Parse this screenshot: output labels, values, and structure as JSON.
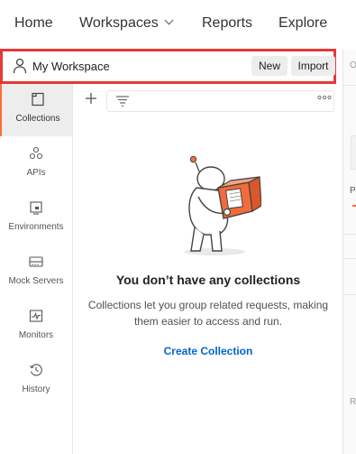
{
  "nav": {
    "items": [
      {
        "label": "Home"
      },
      {
        "label": "Workspaces"
      },
      {
        "label": "Reports"
      },
      {
        "label": "Explore"
      }
    ]
  },
  "workspace": {
    "title": "My Workspace",
    "new_label": "New",
    "import_label": "Import"
  },
  "sidebar": {
    "items": [
      {
        "label": "Collections",
        "icon": "collections-icon",
        "active": true
      },
      {
        "label": "APIs",
        "icon": "apis-icon"
      },
      {
        "label": "Environments",
        "icon": "environments-icon"
      },
      {
        "label": "Mock Servers",
        "icon": "mock-servers-icon"
      },
      {
        "label": "Monitors",
        "icon": "monitors-icon"
      },
      {
        "label": "History",
        "icon": "history-icon"
      }
    ]
  },
  "empty_state": {
    "title": "You don’t have any collections",
    "description": "Collections let you group related requests, making them easier to access and run.",
    "cta": "Create Collection"
  },
  "right_panel": {
    "fragments": [
      "O",
      "P",
      "R"
    ]
  },
  "colors": {
    "accent": "#ff6c37",
    "highlight_border": "#e53935",
    "link": "#0265d2"
  }
}
